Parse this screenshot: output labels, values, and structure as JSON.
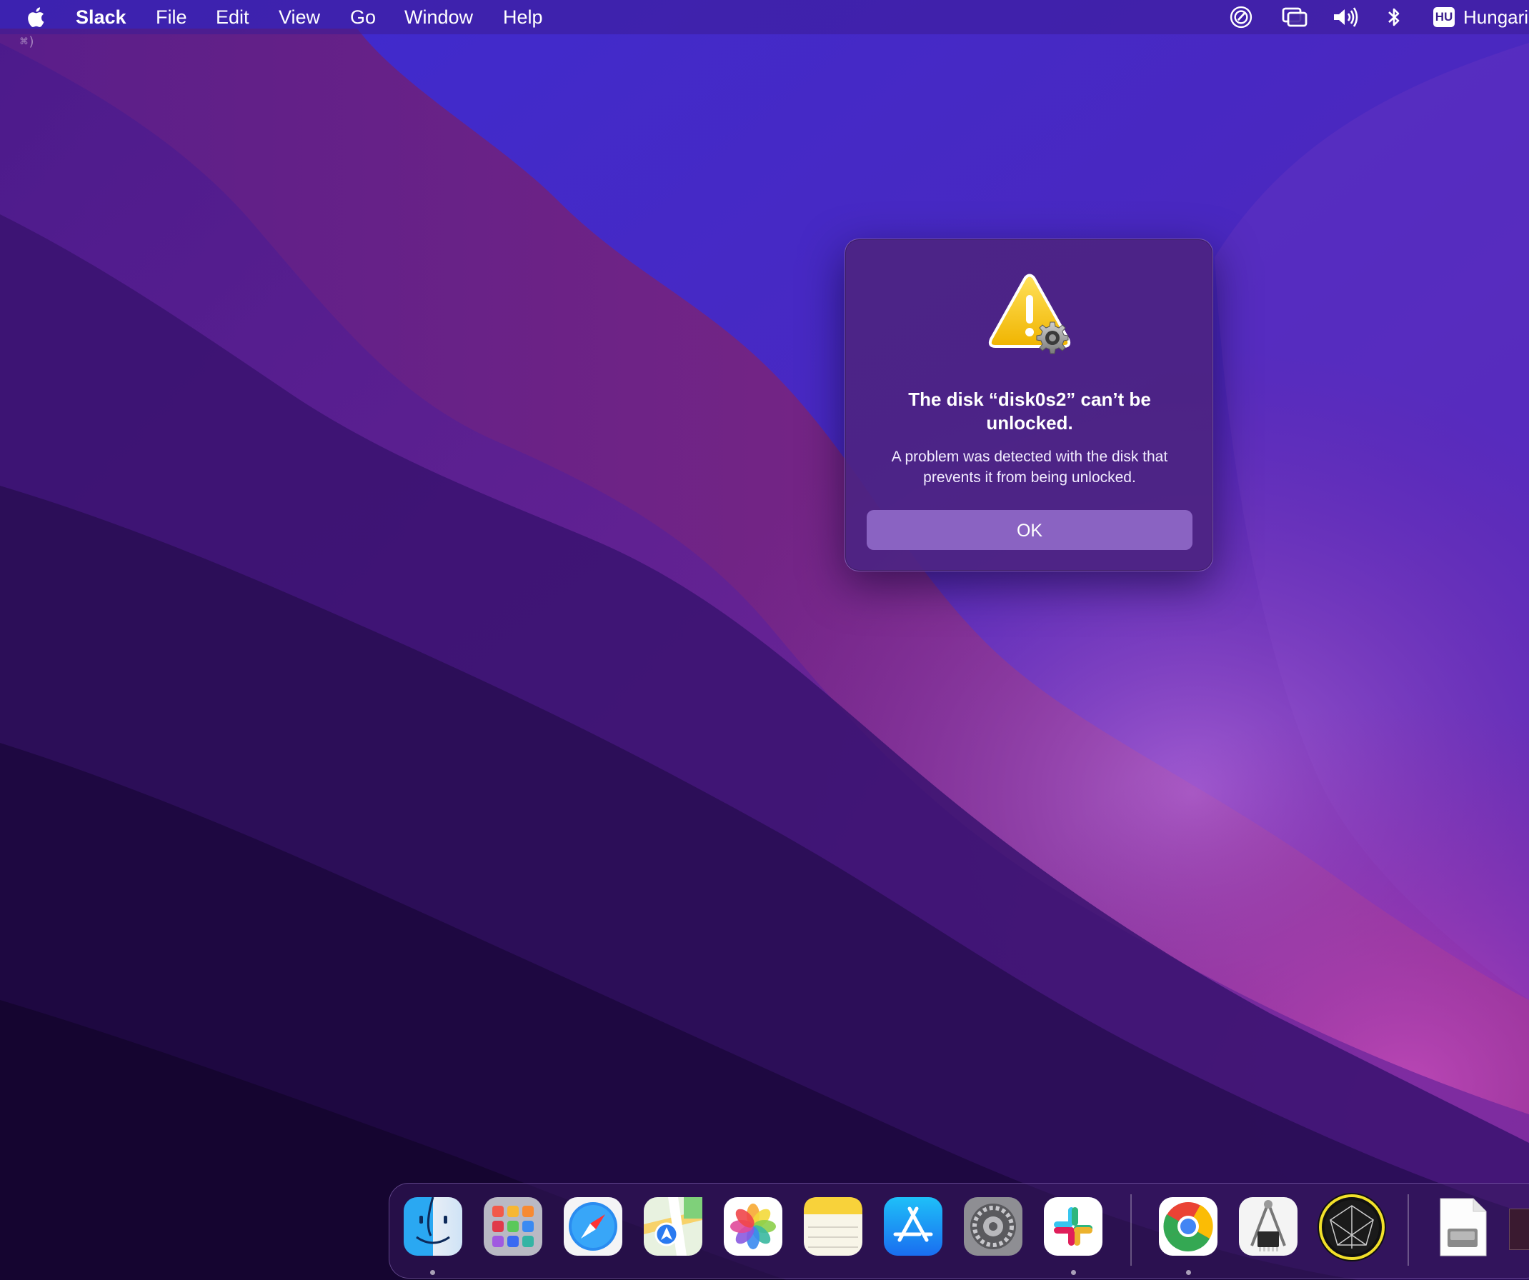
{
  "menubar": {
    "app_name": "Slack",
    "menus": [
      "File",
      "Edit",
      "View",
      "Go",
      "Window",
      "Help"
    ],
    "status": {
      "input_source_badge": "HU",
      "input_source_label": "Hungarian"
    },
    "icons": [
      "apple-icon",
      "focus-icon",
      "screen-mirroring-icon",
      "volume-icon",
      "bluetooth-icon"
    ]
  },
  "desktop": {
    "cmd_hint": "⌘)"
  },
  "dialog": {
    "title": "The disk “disk0s2” can’t be unlocked.",
    "message": "A problem was detected with the disk that prevents it from being unlocked.",
    "ok_label": "OK",
    "icon": "warning-gear-icon"
  },
  "dock": {
    "apps": [
      {
        "name": "Finder",
        "icon": "finder-icon",
        "running": true
      },
      {
        "name": "Launchpad",
        "icon": "launchpad-icon",
        "running": false
      },
      {
        "name": "Safari",
        "icon": "safari-icon",
        "running": false
      },
      {
        "name": "Maps",
        "icon": "maps-icon",
        "running": false
      },
      {
        "name": "Photos",
        "icon": "photos-icon",
        "running": false
      },
      {
        "name": "Notes",
        "icon": "notes-icon",
        "running": false
      },
      {
        "name": "App Store",
        "icon": "app-store-icon",
        "running": false
      },
      {
        "name": "System Preferences",
        "icon": "system-preferences-icon",
        "running": false
      },
      {
        "name": "Slack",
        "icon": "slack-icon",
        "running": true
      },
      {
        "name": "Google Chrome",
        "icon": "chrome-icon",
        "running": true
      },
      {
        "name": "System Information",
        "icon": "system-information-icon",
        "running": false
      },
      {
        "name": "Network Radar",
        "icon": "radar-icon",
        "running": false
      },
      {
        "name": "Disk Image",
        "icon": "disk-image-icon",
        "running": false
      }
    ]
  },
  "colors": {
    "dialog_bg": "#4c2482",
    "ok_button": "#8a63c2",
    "warning_yellow": "#f5c518"
  }
}
